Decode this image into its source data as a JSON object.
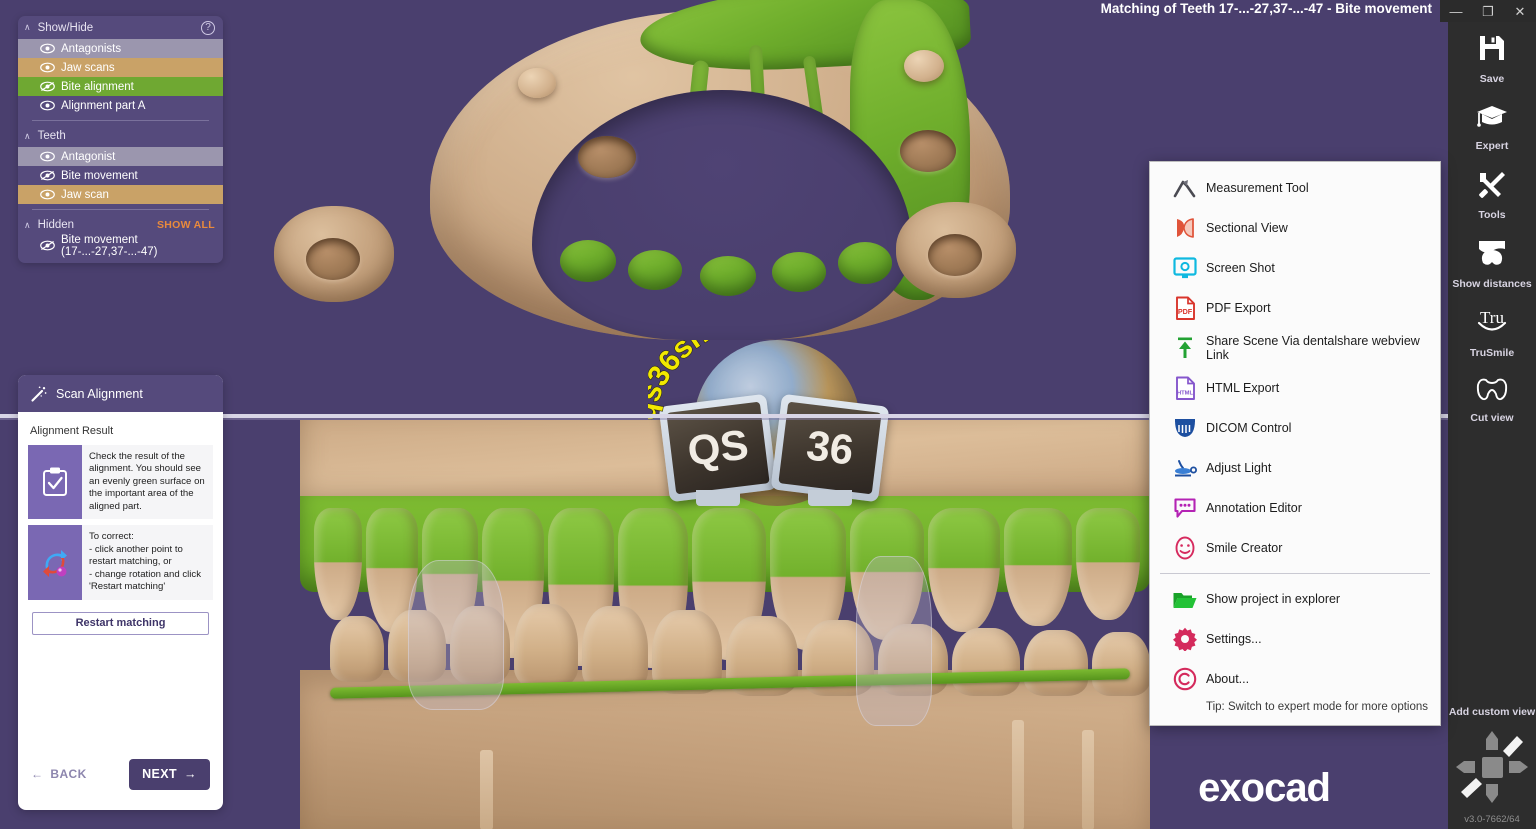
{
  "window": {
    "title": "Matching of Teeth 17-...-27,37-...-47 - Bite movement",
    "minimize_label": "—",
    "maximize_label": "❐",
    "close_label": "✕",
    "version": "v3.0-7662/64",
    "brand": "exocad",
    "background_color": "#4a3f6e"
  },
  "show_hide_panel": {
    "title": "Show/Hide",
    "help_label": "?",
    "collapse_chevron": "∧",
    "groups": [
      {
        "name": "root",
        "header": null,
        "items": [
          {
            "label": "Antagonists",
            "eye": "eye-visible-icon",
            "highlight": "gray"
          },
          {
            "label": "Jaw scans",
            "eye": "eye-visible-icon",
            "highlight": "tan"
          },
          {
            "label": "Bite alignment",
            "eye": "eye-hidden-icon",
            "highlight": "green"
          },
          {
            "label": "Alignment part A",
            "eye": "eye-visible-icon",
            "highlight": "none"
          }
        ]
      },
      {
        "name": "teeth",
        "header": "Teeth",
        "items": [
          {
            "label": "Antagonist",
            "eye": "eye-visible-icon",
            "highlight": "gray"
          },
          {
            "label": "Bite movement",
            "eye": "eye-hidden-icon",
            "highlight": "none"
          },
          {
            "label": "Jaw scan",
            "eye": "eye-visible-icon",
            "highlight": "tan"
          }
        ]
      },
      {
        "name": "hidden",
        "header": "Hidden",
        "action_label": "SHOW ALL",
        "items": [
          {
            "label": "Bite movement (17-...-27,37-...-47)",
            "eye": "eye-hidden-icon",
            "highlight": "none"
          }
        ]
      }
    ]
  },
  "wizard": {
    "title": "Scan Alignment",
    "section_label": "Alignment Result",
    "cards": [
      {
        "icon": "clipboard-check-icon",
        "text": "Check the result of the alignment. You should see an evenly green surface on the important area of the aligned part."
      },
      {
        "icon": "rotate-object-icon",
        "text": "To correct:\n- click another point to restart matching, or\n- change rotation and click 'Restart matching'"
      }
    ],
    "restart_button": "Restart matching",
    "back_button": "BACK",
    "back_arrow": "←",
    "next_button": "NEXT",
    "next_arrow": "→"
  },
  "context_menu": {
    "items": [
      {
        "label": "Measurement Tool",
        "icon": "measurement-tool-icon"
      },
      {
        "label": "Sectional View",
        "icon": "sectional-view-icon"
      },
      {
        "label": "Screen Shot",
        "icon": "screen-shot-icon"
      },
      {
        "label": "PDF Export",
        "icon": "pdf-export-icon"
      },
      {
        "label": "Share Scene Via dentalshare webview Link",
        "icon": "share-upload-icon"
      },
      {
        "label": "HTML Export",
        "icon": "html-export-icon"
      },
      {
        "label": "DICOM Control",
        "icon": "dicom-control-icon"
      },
      {
        "label": "Adjust Light",
        "icon": "adjust-light-icon"
      },
      {
        "label": "Annotation Editor",
        "icon": "annotation-editor-icon"
      },
      {
        "label": "Smile Creator",
        "icon": "smile-creator-icon"
      }
    ],
    "items_after_separator": [
      {
        "label": "Show project in explorer",
        "icon": "folder-open-icon"
      },
      {
        "label": "Settings...",
        "icon": "gear-icon"
      },
      {
        "label": "About...",
        "icon": "copyright-icon"
      }
    ],
    "tip": "Tip: Switch to expert mode for more options"
  },
  "right_toolbar": {
    "items": [
      {
        "label": "Save",
        "icon": "save-icon"
      },
      {
        "label": "Expert",
        "icon": "graduation-cap-icon"
      },
      {
        "label": "Tools",
        "icon": "tools-icon"
      },
      {
        "label": "Show distances",
        "icon": "show-distances-icon"
      },
      {
        "label": "TruSmile",
        "icon": "trusmile-icon"
      },
      {
        "label": "Cut view",
        "icon": "cut-view-icon"
      }
    ],
    "add_custom_view": "Add custom view"
  },
  "watermark": {
    "domain": "qs36shop.com",
    "monitor_left": "QS",
    "monitor_right": "36"
  },
  "colors": {
    "accent_purple": "#4a3f6e",
    "panel_purple": "#554a7c",
    "green_highlight": "#6fa832",
    "tan_highlight": "#c9a267",
    "gray_highlight": "#9b96ae",
    "orange_action": "#e98a3c",
    "model_beige": "#cbac8c",
    "model_green": "#6ba832",
    "toolbar_dark": "#2d2d2d"
  }
}
